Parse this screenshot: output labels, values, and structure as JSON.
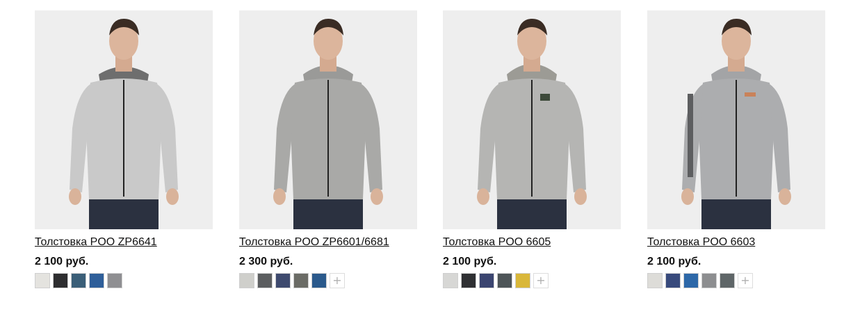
{
  "products": [
    {
      "title": "Толстовка POO ZP6641",
      "price": "2 100 руб.",
      "jacket_color": "#c9c9c9",
      "hood_color": "#6e6e6e",
      "swatches": [
        "#e4e3df",
        "#2e2e30",
        "#3b5f78",
        "#2f5f9a",
        "#8f8f92"
      ],
      "has_more": false
    },
    {
      "title": "Толстовка POO ZP6601/6681",
      "price": "2 300 руб.",
      "jacket_color": "#a9a9a7",
      "hood_color": "#9a9a98",
      "swatches": [
        "#cfcfcb",
        "#5c5e60",
        "#3e4a6e",
        "#6b6c66",
        "#2b5a8c"
      ],
      "has_more": true
    },
    {
      "title": "Толстовка POO 6605",
      "price": "2 100 руб.",
      "jacket_color": "#b5b5b3",
      "hood_color": "#9c9b95",
      "swatches": [
        "#d7d7d5",
        "#2f3033",
        "#3b4570",
        "#4e5558",
        "#d9b739"
      ],
      "has_more": true
    },
    {
      "title": "Толстовка POO 6603",
      "price": "2 100 руб.",
      "jacket_color": "#acadaf",
      "hood_color": "#a3a4a6",
      "swatches": [
        "#dddcd8",
        "#384a7c",
        "#2d68a8",
        "#8d8e90",
        "#5f6668"
      ],
      "has_more": true
    }
  ],
  "more_icon": "plus-icon",
  "more_label": "+"
}
